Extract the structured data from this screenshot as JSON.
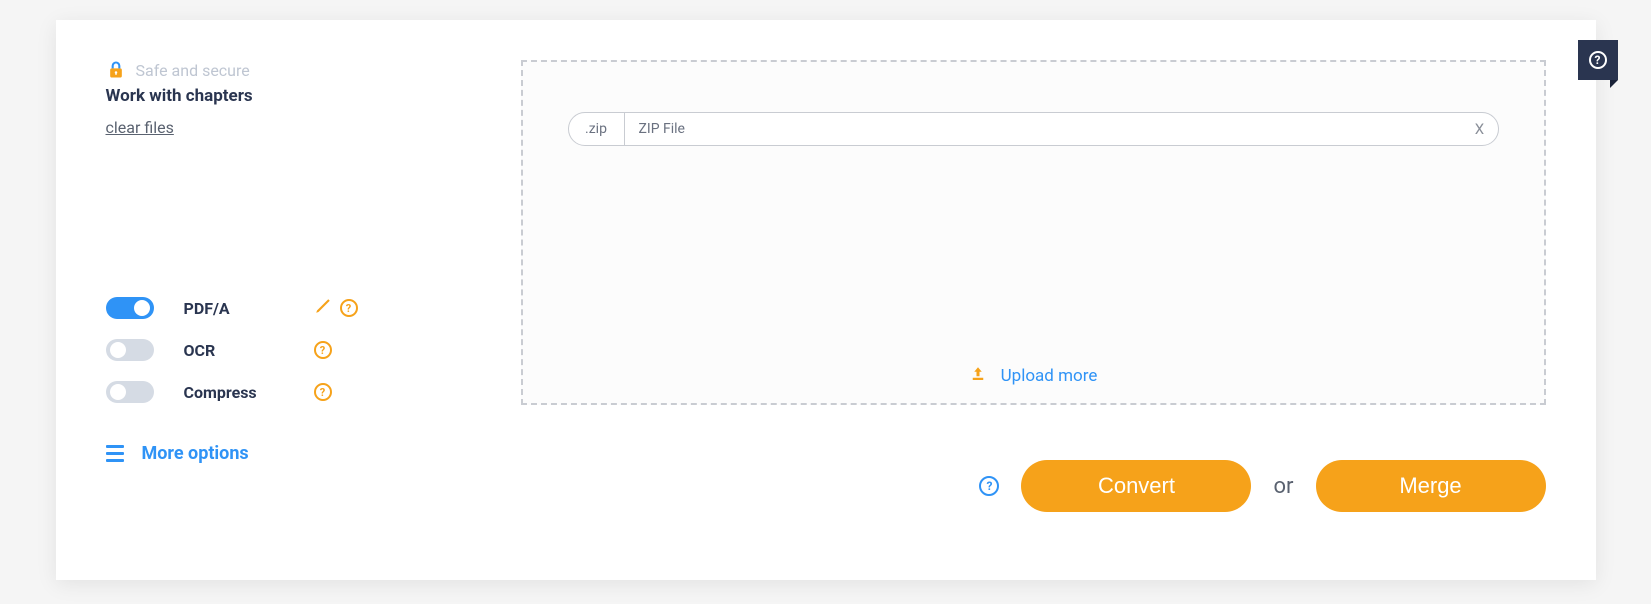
{
  "header": {
    "safe_label": "Safe and secure",
    "work_title": "Work with chapters",
    "clear_link": "clear files"
  },
  "toggles": [
    {
      "label": "PDF/A",
      "on": true,
      "editable": true
    },
    {
      "label": "OCR",
      "on": false,
      "editable": false
    },
    {
      "label": "Compress",
      "on": false,
      "editable": false
    }
  ],
  "more_options_label": "More options",
  "file": {
    "ext": ".zip",
    "name": "ZIP File",
    "remove_label": "X"
  },
  "upload_more_label": "Upload more",
  "actions": {
    "convert": "Convert",
    "or": "or",
    "merge": "Merge"
  }
}
